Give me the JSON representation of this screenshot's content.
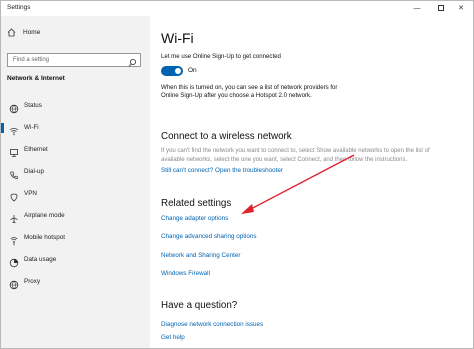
{
  "window": {
    "title": "Settings"
  },
  "sidebar": {
    "home_label": "Home",
    "search_placeholder": "Find a setting",
    "section_title": "Network & Internet",
    "items": [
      {
        "label": "Status",
        "icon": "globe-icon",
        "selected": false
      },
      {
        "label": "Wi-Fi",
        "icon": "wifi-icon",
        "selected": true
      },
      {
        "label": "Ethernet",
        "icon": "ethernet-icon",
        "selected": false
      },
      {
        "label": "Dial-up",
        "icon": "phone-icon",
        "selected": false
      },
      {
        "label": "VPN",
        "icon": "vpn-icon",
        "selected": false
      },
      {
        "label": "Airplane mode",
        "icon": "airplane-icon",
        "selected": false
      },
      {
        "label": "Mobile hotspot",
        "icon": "hotspot-icon",
        "selected": false
      },
      {
        "label": "Data usage",
        "icon": "data-usage-icon",
        "selected": false
      },
      {
        "label": "Proxy",
        "icon": "globe-icon",
        "selected": false
      }
    ]
  },
  "main": {
    "title": "Wi-Fi",
    "signup_label": "Let me use Online Sign-Up to get connected",
    "toggle_state": "On",
    "signup_desc": [
      "When this is turned on, you can see a list of network providers for",
      "Online Sign-Up after you choose a Hotspot 2.0 network."
    ],
    "connect": {
      "heading": "Connect to a wireless network",
      "desc": [
        "If you can't find the network you want to connect to, select Show available networks to open the list of",
        "available networks, select the one you want, select Connect, and then follow the instructions."
      ],
      "troubleshooter": "Still can't connect? Open the troubleshooter"
    },
    "related": {
      "heading": "Related settings",
      "links": [
        "Change adapter options",
        "Change advanced sharing options",
        "Network and Sharing Center",
        "Windows Firewall"
      ]
    },
    "question": {
      "heading": "Have a question?",
      "links": [
        "Diagnose network connection issues",
        "Get help"
      ]
    }
  },
  "colors": {
    "accent": "#0063b1",
    "annotation_arrow": "#e0212b",
    "sidebar_bg": "#f2f2f2"
  }
}
